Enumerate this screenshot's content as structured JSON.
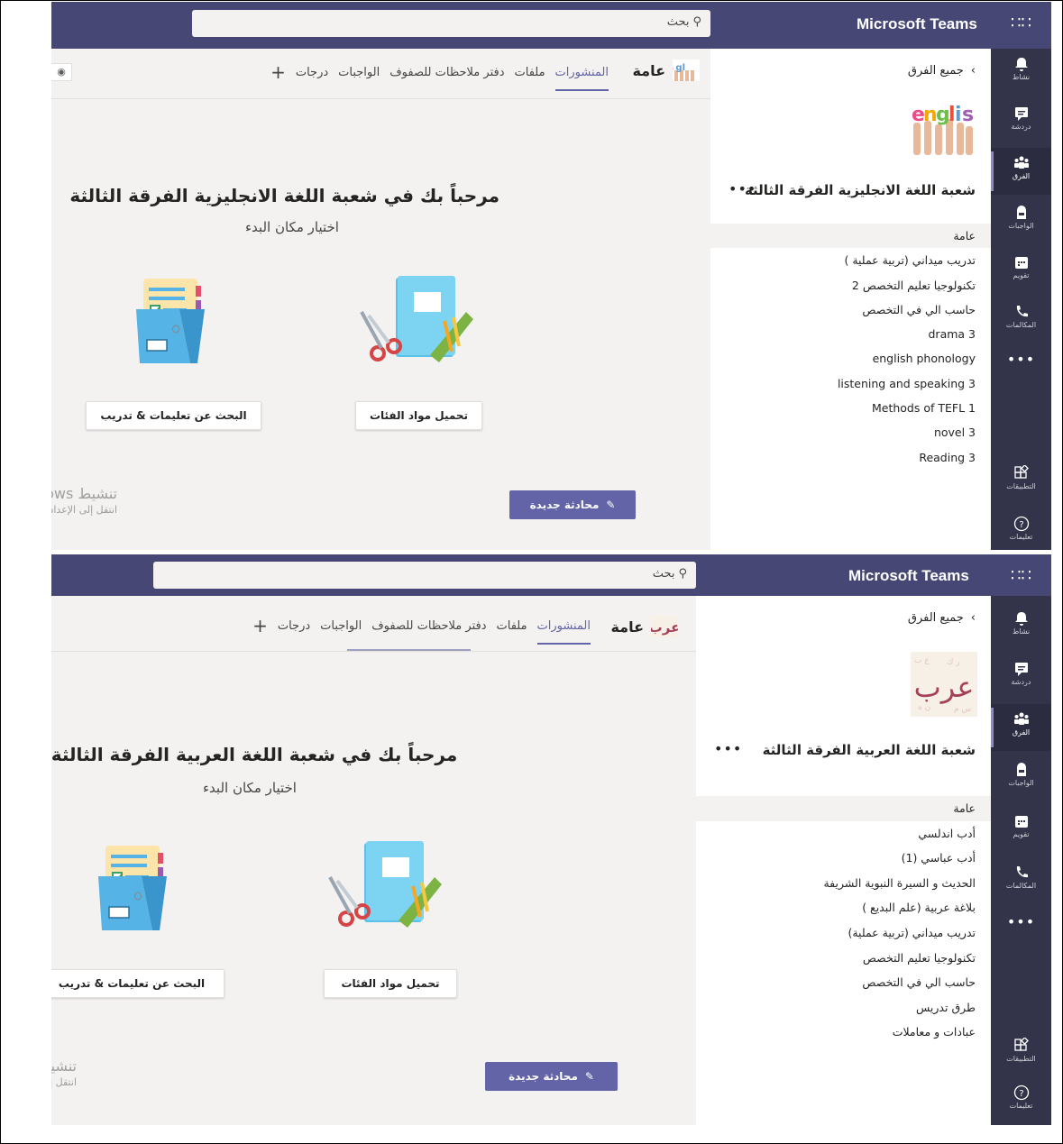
{
  "screens": [
    {
      "app_title": "Microsoft Teams",
      "search_placeholder": "بحث",
      "rail": [
        "نشاط",
        "دردشة",
        "الفرق",
        "الواجبات",
        "تقويم",
        "المكالمات",
        "التطبيقات",
        "تعليمات"
      ],
      "back_label": "جميع الفرق",
      "team_name": "شعبة اللغة الانجليزية الفرقة الثالثة",
      "team_image_text": "english",
      "channels": [
        "عامة",
        "تدريب ميداني (تربية عملية )",
        "تكنولوجيا تعليم التخصص 2",
        "حاسب الي في التخصص",
        "drama 3",
        "english phonology",
        "listening and speaking 3",
        "Methods of TEFL 1",
        "novel 3",
        "Reading 3"
      ],
      "channel_title": "عامة",
      "tabs": [
        "المنشورات",
        "ملفات",
        "دفتر ملاحظات للصفوف",
        "الواجبات",
        "درجات"
      ],
      "welcome": "مرحباً بك في شعبة اللغة الانجليزية الفرقة الثالثة",
      "subtitle": "اختيار مكان البدء",
      "btn_upload": "تحميل مواد الفئات",
      "btn_search": "البحث عن تعليمات & تدريب",
      "new_conversation": "محادثة جديدة",
      "activate_line1": "تنشيط Windows",
      "activate_line2": "انتقل إلى الإعدادات"
    },
    {
      "app_title": "Microsoft Teams",
      "search_placeholder": "بحث",
      "rail": [
        "نشاط",
        "دردشة",
        "الفرق",
        "الواجبات",
        "تقويم",
        "المكالمات",
        "التطبيقات",
        "تعليمات"
      ],
      "back_label": "جميع الفرق",
      "team_name": "شعبة اللغة العربية الفرقة الثالثة",
      "team_image_text": "عرب",
      "channels": [
        "عامة",
        "أدب اندلسي",
        "أدب عباسي (1)",
        "الحديث و السيرة النبوية الشريفة",
        "بلاغة عربية (علم البديع )",
        "تدريب ميداني (تربية عملية)",
        "تكنولوجيا تعليم التخصص",
        "حاسب الي في التخصص",
        "طرق تدريس",
        "عبادات و معاملات"
      ],
      "channel_title": "عامة",
      "tabs": [
        "المنشورات",
        "ملفات",
        "دفتر ملاحظات للصفوف",
        "الواجبات",
        "درجات"
      ],
      "welcome": "مرحباً بك في شعبة اللغة العربية الفرقة الثالثة",
      "subtitle": "اختيار مكان البدء",
      "btn_upload": "تحميل مواد الفئات",
      "btn_search": "البحث عن تعليمات & تدريب",
      "new_conversation": "محادثة جديدة",
      "activate_line1": "تنشيط Windows",
      "activate_line2": "انتقل إلى الإعدادات"
    }
  ],
  "colors": {
    "topbar": "#464775",
    "rail": "#33344a",
    "accent": "#6264a7",
    "background": "#f3f2f1"
  }
}
